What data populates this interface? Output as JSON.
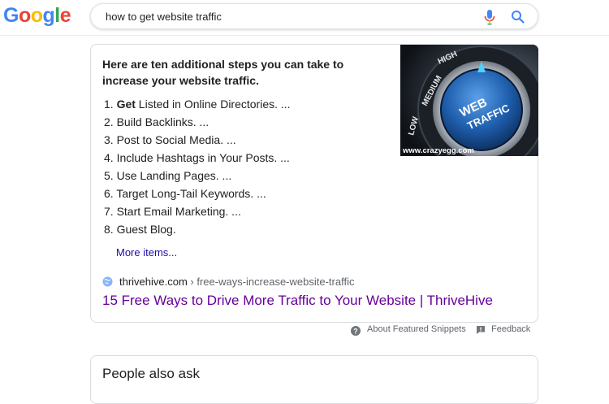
{
  "logo": {
    "letters": [
      "G",
      "o",
      "o",
      "g",
      "l",
      "e"
    ],
    "colors": [
      "#4285F4",
      "#EA4335",
      "#FBBC05",
      "#4285F4",
      "#34A853",
      "#EA4335"
    ]
  },
  "search": {
    "query": "how to get website traffic",
    "mic_icon": "microphone-icon",
    "search_icon": "magnifier-icon"
  },
  "snippet": {
    "intro": "Here are ten additional steps you can take to increase your website traffic.",
    "steps": [
      {
        "num": "1.",
        "bold": "Get",
        "text": " Listed in Online Directories. ..."
      },
      {
        "num": "2.",
        "bold": "",
        "text": "Build Backlinks. ..."
      },
      {
        "num": "3.",
        "bold": "",
        "text": "Post to Social Media. ..."
      },
      {
        "num": "4.",
        "bold": "",
        "text": "Include Hashtags in Your Posts. ..."
      },
      {
        "num": "5.",
        "bold": "",
        "text": "Use Landing Pages. ..."
      },
      {
        "num": "6.",
        "bold": "",
        "text": "Target Long-Tail Keywords. ..."
      },
      {
        "num": "7.",
        "bold": "",
        "text": "Start Email Marketing. ..."
      },
      {
        "num": "8.",
        "bold": "",
        "text": "Guest Blog."
      }
    ],
    "more_label": "More items...",
    "image": {
      "dial_labels": [
        "LOW",
        "MEDIUM",
        "HIGH"
      ],
      "knob_text": [
        "WEB",
        "TRAFFIC"
      ],
      "credit": "www.crazyegg.com"
    },
    "source": {
      "domain": "thrivehive.com",
      "path": " › free-ways-increase-website-traffic"
    },
    "result_title": "15 Free Ways to Drive More Traffic to Your Website | ThriveHive"
  },
  "footer": {
    "about_label": "About Featured Snippets",
    "feedback_label": "Feedback"
  },
  "paa": {
    "title": "People also ask"
  }
}
